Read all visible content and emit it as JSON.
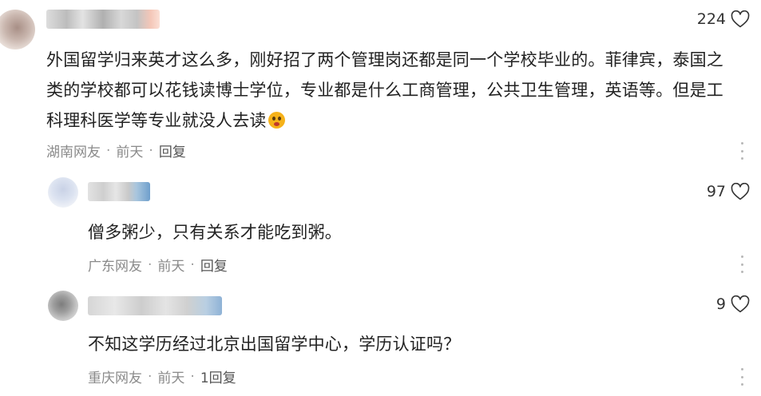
{
  "comments": [
    {
      "likes": "224",
      "text": "外国留学归来英才这么多，刚好招了两个管理岗还都是同一个学校毕业的。菲律宾，泰国之类的学校都可以花钱读博士学位，专业都是什么工商管理，公共卫生管理，英语等。但是工科理科医学等专业就没人去读",
      "emoji": "flushed-face-emoji",
      "location": "湖南网友",
      "sep1": "·",
      "time": "前天",
      "sep2": "·",
      "reply": "回复"
    },
    {
      "likes": "97",
      "text": "僧多粥少，只有关系才能吃到粥。",
      "location": "广东网友",
      "sep1": "·",
      "time": "前天",
      "sep2": "·",
      "reply": "回复"
    },
    {
      "likes": "9",
      "text": "不知这学历经过北京出国留学中心，学历认证吗？",
      "location": "重庆网友",
      "sep1": "·",
      "time": "前天",
      "sep2": "·",
      "reply": "1回复"
    }
  ],
  "icons": {
    "like": "heart-outline-icon",
    "more": "more-vertical-icon"
  },
  "colors": {
    "text": "#222222",
    "meta": "#8a8a8a",
    "reply": "#555555",
    "icon": "#333333"
  }
}
